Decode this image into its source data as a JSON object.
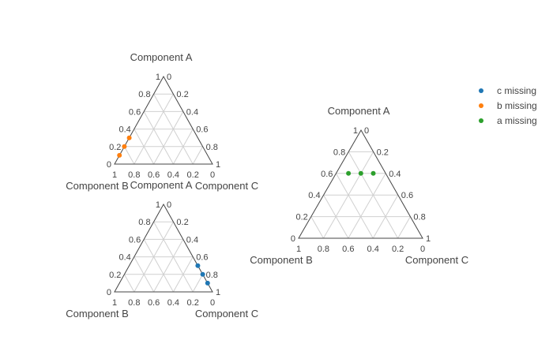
{
  "chart_data": [
    {
      "type": "scatter",
      "subtype": "ternary",
      "name": "b missing",
      "color": "#ff7f0e",
      "axes": {
        "a": "Component A",
        "b": "Component B",
        "c": "Component C"
      },
      "ticks": [
        "0",
        "0.2",
        "0.4",
        "0.6",
        "0.8",
        "1"
      ],
      "grid": true,
      "points": [
        {
          "a": 0.3,
          "b": 0.7,
          "c": 0.0
        },
        {
          "a": 0.2,
          "b": 0.8,
          "c": 0.0
        },
        {
          "a": 0.1,
          "b": 0.9,
          "c": 0.0
        }
      ]
    },
    {
      "type": "scatter",
      "subtype": "ternary",
      "name": "c missing",
      "color": "#1f77b4",
      "axes": {
        "a": "Component A",
        "b": "Component B",
        "c": "Component C"
      },
      "ticks": [
        "0",
        "0.2",
        "0.4",
        "0.6",
        "0.8",
        "1"
      ],
      "grid": true,
      "points": [
        {
          "a": 0.3,
          "b": 0.0,
          "c": 0.7
        },
        {
          "a": 0.2,
          "b": 0.0,
          "c": 0.8
        },
        {
          "a": 0.1,
          "b": 0.0,
          "c": 0.9
        }
      ]
    },
    {
      "type": "scatter",
      "subtype": "ternary",
      "name": "a missing",
      "color": "#2ca02c",
      "axes": {
        "a": "Component A",
        "b": "Component B",
        "c": "Component C"
      },
      "ticks": [
        "0",
        "0.2",
        "0.4",
        "0.6",
        "0.8",
        "1"
      ],
      "grid": true,
      "points": [
        {
          "a": 0.6,
          "b": 0.3,
          "c": 0.1
        },
        {
          "a": 0.6,
          "b": 0.2,
          "c": 0.2
        },
        {
          "a": 0.6,
          "b": 0.1,
          "c": 0.3
        }
      ]
    }
  ],
  "legend": {
    "placement": "top-right",
    "items": [
      {
        "label": "c missing",
        "color": "#1f77b4"
      },
      {
        "label": "b missing",
        "color": "#ff7f0e"
      },
      {
        "label": "a missing",
        "color": "#2ca02c"
      }
    ]
  }
}
